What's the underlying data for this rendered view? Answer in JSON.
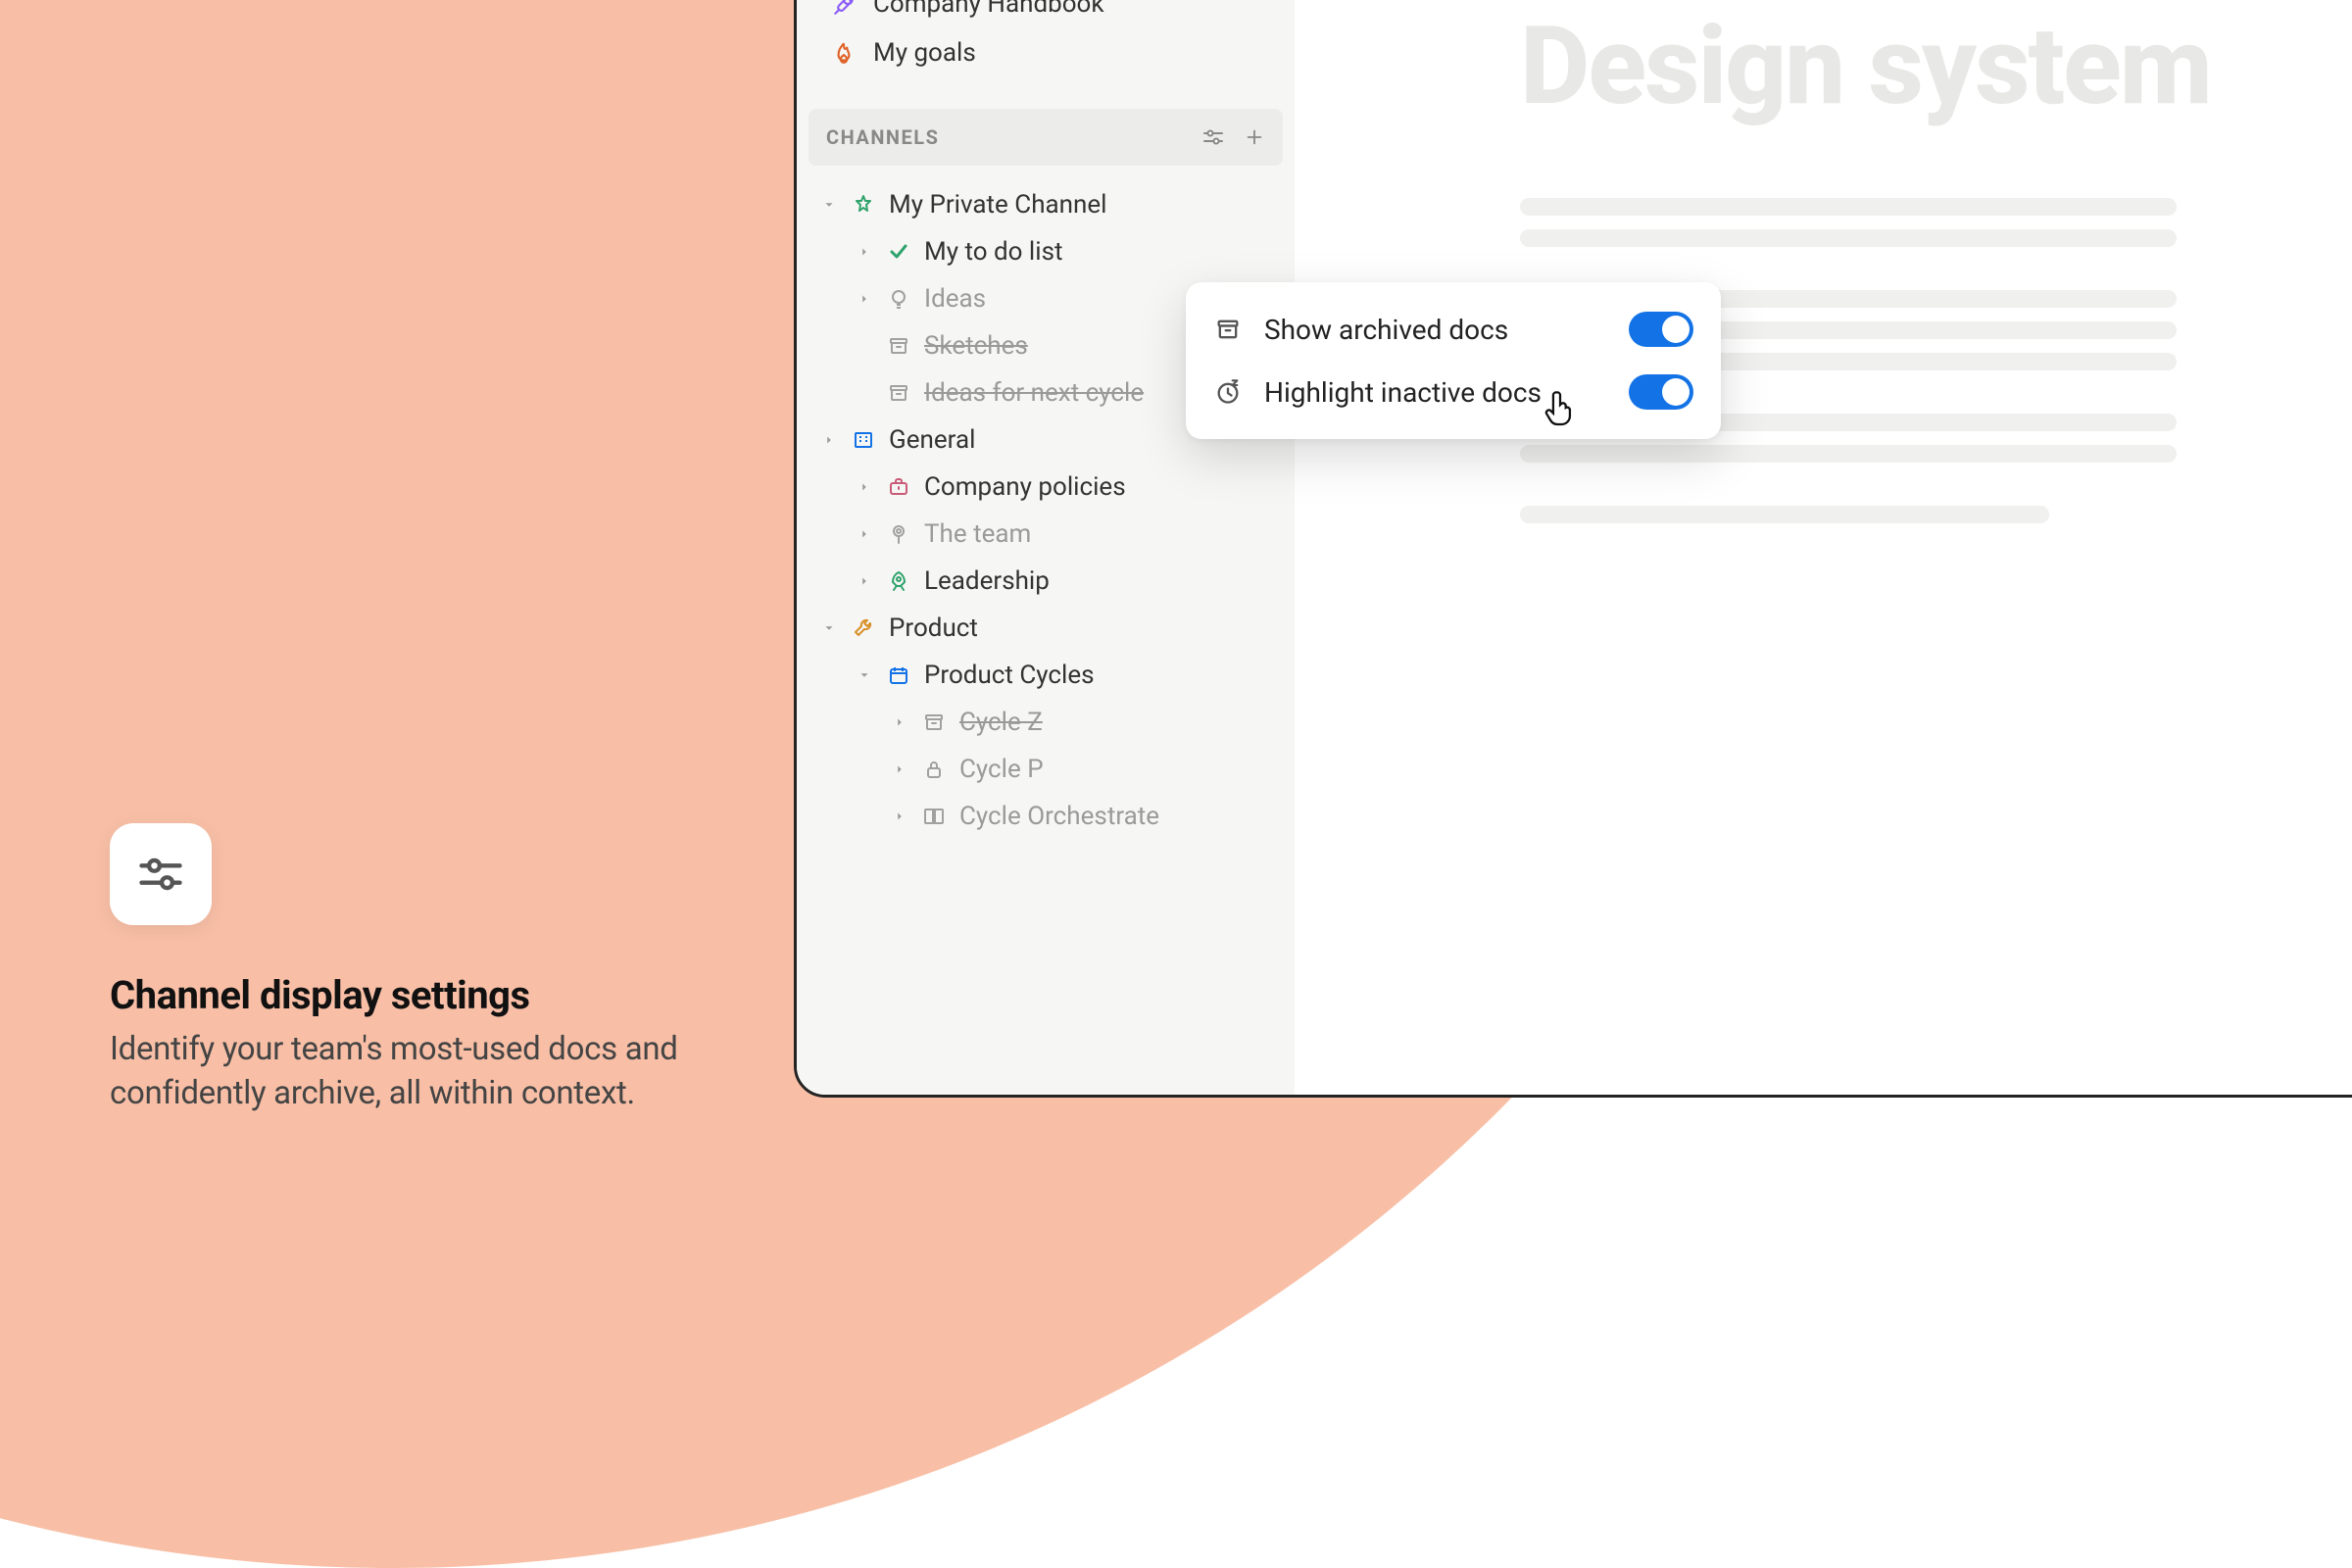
{
  "promo": {
    "title": "Channel display settings",
    "description": "Identify your team's most-used docs and confidently archive, all within context."
  },
  "sidebar": {
    "top_docs": [
      {
        "label": "Company Handbook",
        "icon": "microphone"
      },
      {
        "label": "My goals",
        "icon": "flame"
      }
    ],
    "channels_header": "CHANNELS",
    "tree": [
      {
        "label": "My Private Channel",
        "depth": 0,
        "icon": "star",
        "icon_color": "#2FA36B",
        "caret": "down"
      },
      {
        "label": "My to do list",
        "depth": 1,
        "icon": "check",
        "icon_color": "#2FA36B",
        "caret": "right"
      },
      {
        "label": "Ideas",
        "depth": 1,
        "icon": "bulb",
        "icon_color": "#A1A1A1",
        "caret": "right",
        "faded": true
      },
      {
        "label": "Sketches",
        "depth": 1,
        "icon": "archive",
        "icon_color": "#A1A1A1",
        "caret": "none",
        "faded": true,
        "struck": true
      },
      {
        "label": "Ideas for next cycle",
        "depth": 1,
        "icon": "archive",
        "icon_color": "#A1A1A1",
        "caret": "none",
        "faded": true,
        "struck": true
      },
      {
        "label": "General",
        "depth": 0,
        "icon": "office",
        "icon_color": "#1373E6",
        "caret": "right"
      },
      {
        "label": "Company policies",
        "depth": 1,
        "icon": "briefcase",
        "icon_color": "#C85C78",
        "caret": "right"
      },
      {
        "label": "The team",
        "depth": 1,
        "icon": "pin",
        "icon_color": "#A1A1A1",
        "caret": "right",
        "faded": true
      },
      {
        "label": "Leadership",
        "depth": 1,
        "icon": "rocket",
        "icon_color": "#2FA36B",
        "caret": "right"
      },
      {
        "label": "Product",
        "depth": 0,
        "icon": "wrench",
        "icon_color": "#D9902B",
        "caret": "down"
      },
      {
        "label": "Product Cycles",
        "depth": 1,
        "icon": "calendar",
        "icon_color": "#1373E6",
        "caret": "down"
      },
      {
        "label": "Cycle Z",
        "depth": 2,
        "icon": "archive",
        "icon_color": "#A1A1A1",
        "caret": "right",
        "faded": true,
        "struck": true
      },
      {
        "label": "Cycle P",
        "depth": 2,
        "icon": "lock",
        "icon_color": "#A1A1A1",
        "caret": "right",
        "faded": true
      },
      {
        "label": "Cycle Orchestrate",
        "depth": 2,
        "icon": "book",
        "icon_color": "#A1A1A1",
        "caret": "right",
        "faded": true
      }
    ]
  },
  "content": {
    "title": "Design system"
  },
  "popup": {
    "items": [
      {
        "label": "Show archived docs",
        "icon": "archive",
        "checked": true
      },
      {
        "label": "Highlight inactive docs",
        "icon": "clock-sleep",
        "checked": true
      }
    ]
  }
}
